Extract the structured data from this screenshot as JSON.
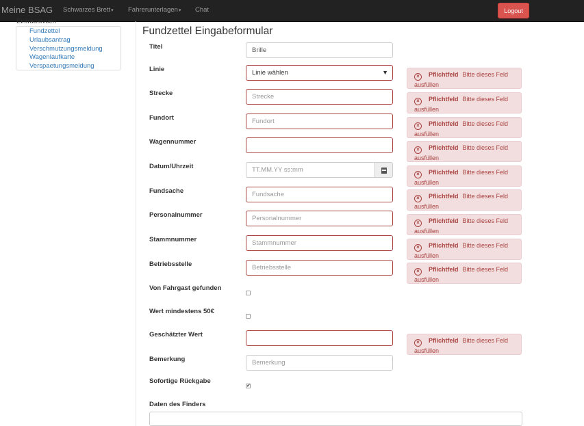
{
  "navbar": {
    "brand": "Meine BSAG",
    "items": [
      {
        "label": "Schwarzes Brett",
        "caret": "▾"
      },
      {
        "label": "Fahrerunterlagen",
        "caret": "▾"
      },
      {
        "label": "Chat"
      }
    ],
    "logout_label": "Logout"
  },
  "sidebar": {
    "heading": "Eintragstypen",
    "items": [
      {
        "label": "Fundzettel"
      },
      {
        "label": "Urlaubsantrag"
      },
      {
        "label": "Verschmutzungsmeldung"
      },
      {
        "label": "Wagenlaufkarte"
      },
      {
        "label": "Verspaetungsmeldung"
      }
    ]
  },
  "form": {
    "title": "Fundzettel Eingabeformular",
    "titel": {
      "label": "Titel",
      "value": "Brille"
    },
    "linie": {
      "label": "Linie",
      "value": "Linie wählen"
    },
    "strecke": {
      "label": "Strecke",
      "placeholder": "Strecke"
    },
    "fundort": {
      "label": "Fundort",
      "placeholder": "Fundort"
    },
    "wagennummer": {
      "label": "Wagennummer",
      "placeholder": ""
    },
    "datum": {
      "label": "Datum/Uhrzeit",
      "placeholder": "TT.MM.YY ss:mm",
      "icon": "calendar-icon"
    },
    "fundsache": {
      "label": "Fundsache",
      "placeholder": "Fundsache"
    },
    "personalnummer": {
      "label": "Personalnummer",
      "placeholder": "Personalnummer"
    },
    "stammnummer": {
      "label": "Stammnummer",
      "placeholder": "Stammnummer"
    },
    "betriebsstelle": {
      "label": "Betriebsstelle",
      "placeholder": "Betriebsstelle"
    },
    "von_fahrgast": {
      "label": "Von Fahrgast gefunden",
      "checked": false
    },
    "wert_min": {
      "label": "Wert mindestens 50€",
      "checked": false
    },
    "geschaetzter_wert": {
      "label": "Geschätzter Wert",
      "placeholder": ""
    },
    "bemerkung": {
      "label": "Bemerkung",
      "placeholder": "Bemerkung"
    },
    "sofortige": {
      "label": "Sofortige Rückgabe",
      "checked": true,
      "check_mark": "✔"
    },
    "finder": {
      "label": "Daten des Finders"
    }
  },
  "validation": {
    "icon": "×",
    "title": "Pflichtfeld",
    "message": "Bitte dieses Feld ausfüllen"
  },
  "colors": {
    "navbar_bg": "#222222",
    "logout_bg": "#d9534f",
    "error": "#a94442",
    "alert_bg": "#f2dede",
    "link": "#337ab7"
  }
}
